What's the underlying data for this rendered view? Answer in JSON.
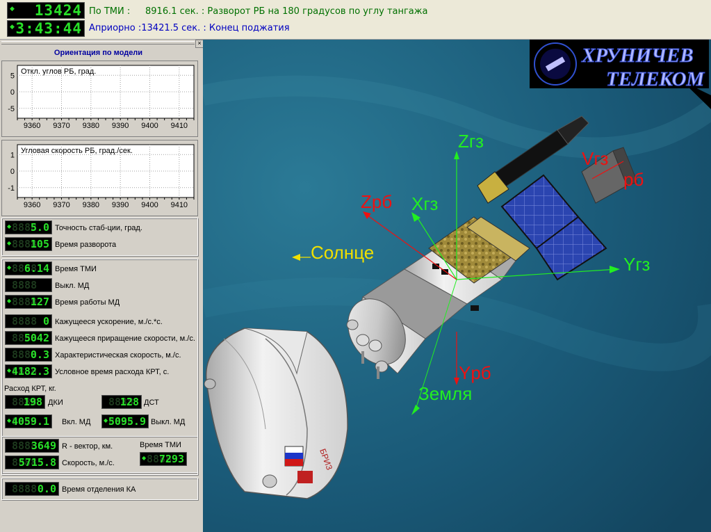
{
  "top": {
    "clock_mission": "13424",
    "clock_time": "3:43:44",
    "tmi_label": "По ТМИ :",
    "tmi_value": "8916.1 сек. : Разворот РБ на 180 градусов по углу тангажа",
    "apriori_value": "Априорно :13421.5 сек. : Конец поджатия"
  },
  "panel": {
    "title": "Ориентация по модели",
    "close_glyph": "×",
    "chart1": {
      "title": "Откл. углов РБ, град."
    },
    "chart2": {
      "title": "Угловая скорость РБ, град./сек."
    },
    "stab": [
      {
        "value": "5.0",
        "label": "Точность стаб-ции, град."
      },
      {
        "value": "105",
        "label": "Время разворота"
      }
    ],
    "tmi": [
      {
        "value": "6.14",
        "label": "Время ТМИ"
      },
      {
        "value": "",
        "label": "Выкл. МД"
      },
      {
        "value": "127",
        "label": "Время работы МД"
      },
      {
        "value": "0",
        "label": "Кажущееся ускорение, м./с.*с."
      },
      {
        "value": "5042",
        "label": "Кажущееся приращение скорости, м./с."
      },
      {
        "value": "0.3",
        "label": "Характеристическая скорость, м./с."
      },
      {
        "value": "4182.3",
        "label": "Условное время расхода КРТ, с."
      }
    ],
    "krt_title": "Расход КРТ, кг.",
    "dki": {
      "value": "198",
      "label": "ДКИ"
    },
    "dst": {
      "value": "128",
      "label": "ДСТ"
    },
    "vkl": {
      "value": "4059.1",
      "label": "Вкл. МД"
    },
    "vykl": {
      "value": "5095.9",
      "label": "Выкл. МД"
    },
    "r_vector": {
      "value": "3649",
      "label": "R - вектор, км."
    },
    "speed": {
      "value": "5715.8",
      "label": "Скорость, м./с."
    },
    "tmi_time": {
      "label": "Время ТМИ",
      "value": "7293"
    },
    "sep": {
      "value": "0.0",
      "label": "Время отделения КА"
    }
  },
  "chart_data": [
    {
      "type": "line",
      "title": "Откл. углов РБ, град.",
      "x_ticks": [
        "9360",
        "9370",
        "9380",
        "9390",
        "9400",
        "9410"
      ],
      "y_ticks": [
        "5",
        "0",
        "-5"
      ],
      "xlim": [
        9355,
        9415
      ],
      "ylim": [
        -8,
        8
      ],
      "grid": true,
      "series": []
    },
    {
      "type": "line",
      "title": "Угловая скорость РБ, град./сек.",
      "x_ticks": [
        "9360",
        "9370",
        "9380",
        "9390",
        "9400",
        "9410"
      ],
      "y_ticks": [
        "1",
        "0",
        "-1"
      ],
      "xlim": [
        9355,
        9415
      ],
      "ylim": [
        -1.6,
        1.6
      ],
      "grid": true,
      "series": []
    }
  ],
  "scene": {
    "logo_line1": "ХРУНИЧЕВ",
    "logo_line2": "ТЕЛЕКОМ",
    "axes": {
      "z_gz": "Zгз",
      "x_gz": "Xгз",
      "y_gz": "Yгз",
      "v_gz": "Vгз",
      "z_rb": "Zрб",
      "y_rb": "Yрб",
      "x_rb_partial": "рб",
      "sun": "Солнце",
      "earth": "Земля"
    },
    "colors": {
      "gz": "#22ee22",
      "rb": "#ee1111",
      "sun": "#f0e000",
      "sea": "#1c5f7a"
    }
  }
}
